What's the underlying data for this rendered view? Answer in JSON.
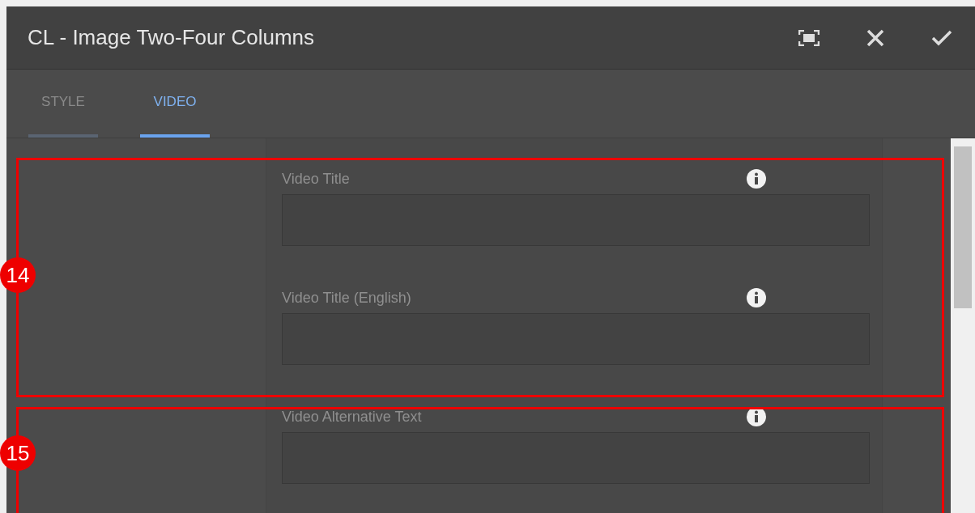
{
  "dialog": {
    "title": "CL - Image Two-Four Columns"
  },
  "tabs": [
    {
      "label": "STYLE",
      "selected": false
    },
    {
      "label": "VIDEO",
      "selected": true
    }
  ],
  "fields": [
    {
      "label": "Video Title"
    },
    {
      "label": "Video Title (English)"
    },
    {
      "label": "Video Alternative Text"
    }
  ],
  "callouts": [
    {
      "number": "14"
    },
    {
      "number": "15"
    }
  ]
}
